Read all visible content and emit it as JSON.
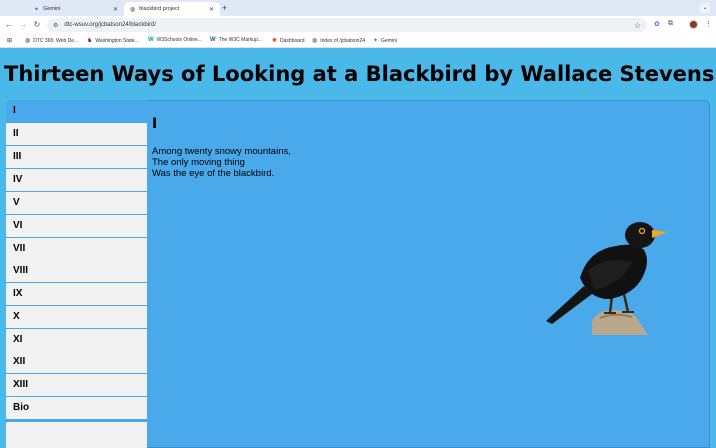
{
  "browser": {
    "tabs": [
      {
        "title": "Gemini",
        "active": false
      },
      {
        "title": "blackbird project",
        "active": true
      }
    ],
    "url": "dtc-wsuv.org/jcbatson24/blackbird/",
    "bookmarks": [
      {
        "label": "DTC 365: Web De...",
        "icon": "globe-icon"
      },
      {
        "label": "Washington State...",
        "icon": "wsu-icon"
      },
      {
        "label": "W3Schools Online...",
        "icon": "w3schools-icon"
      },
      {
        "label": "The W3C Markup...",
        "icon": "w3c-icon"
      },
      {
        "label": "Dashboard",
        "icon": "canvas-icon"
      },
      {
        "label": "Index of /jcbatson24",
        "icon": "globe-icon"
      },
      {
        "label": "Gemini",
        "icon": "gemini-icon"
      }
    ]
  },
  "page": {
    "title": "Thirteen Ways of Looking at a Blackbird by Wallace Stevens",
    "nav": [
      {
        "label": "I",
        "active": true
      },
      {
        "label": "II"
      },
      {
        "label": "III"
      },
      {
        "label": "IV"
      },
      {
        "label": "V"
      },
      {
        "label": "VI"
      },
      {
        "label": "VII"
      },
      {
        "label": "VIII"
      },
      {
        "label": "IX"
      },
      {
        "label": "X"
      },
      {
        "label": "XI"
      },
      {
        "label": "XII"
      },
      {
        "label": "XIII"
      },
      {
        "label": "Bio"
      }
    ],
    "stanza": {
      "heading": "I",
      "lines": [
        "Among twenty snowy mountains,",
        "The only moving thing",
        "Was the eye of the blackbird."
      ]
    }
  },
  "colors": {
    "page_background": "#4ab8e8",
    "panel_background": "#4aa9ea",
    "sidebar_background": "#f2f2f2"
  }
}
